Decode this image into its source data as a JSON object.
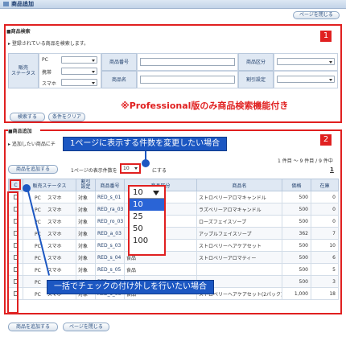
{
  "window": {
    "title": "商品追加",
    "close_label": "ページを閉じる"
  },
  "search": {
    "header": "■商品検索",
    "subtitle": "▸ 登録されている商品を検索します。",
    "status_label": "販売\nステータス",
    "status_rows": [
      {
        "label": "PC",
        "value": ""
      },
      {
        "label": "携帯",
        "value": ""
      },
      {
        "label": "スマホ",
        "value": ""
      }
    ],
    "product_number_label": "商品番号",
    "product_name_label": "商品名",
    "category_label": "商品区分",
    "discount_label": "割引設定",
    "search_button": "検索する",
    "clear_button": "条件をクリア",
    "note": "※Professional版のみ商品検索機能付き",
    "badge": "1"
  },
  "add": {
    "header": "■商品追加",
    "subtitle": "▸ 追加したい商品にチ",
    "badge": "2",
    "add_button": "商品を追加する",
    "per_page_prefix": "1ページの表示件数を",
    "per_page_value": "10",
    "per_page_suffix": "にする",
    "count_text": "1 件目 ～ 9 件目 / 9 件中",
    "page_number": "1",
    "columns": [
      "C",
      "販売ステータス",
      "割引\n設定",
      "商品番号",
      "商品区分",
      "商品名",
      "価格",
      "在庫"
    ],
    "rows": [
      {
        "status1": "PC",
        "status2": "スマホ",
        "discount": "対象",
        "number": "RED_s_01",
        "category": "",
        "name": "ストロベリーアロマキャンドル",
        "price": "500",
        "stock": "0"
      },
      {
        "status1": "PC",
        "status2": "スマホ",
        "discount": "対象",
        "number": "RED_ra_03",
        "category": "",
        "name": "ラズベリーアロマキャンドル",
        "price": "500",
        "stock": "0"
      },
      {
        "status1": "PC",
        "status2": "スマホ",
        "discount": "対象",
        "number": "RED_ro_03",
        "category": "",
        "name": "ローズフェイスソープ",
        "price": "500",
        "stock": "0"
      },
      {
        "status1": "PC",
        "status2": "スマホ",
        "discount": "対象",
        "number": "RED_a_03",
        "category": "",
        "name": "アップルフェイスソープ",
        "price": "362",
        "stock": "7"
      },
      {
        "status1": "PC",
        "status2": "スマホ",
        "discount": "対象",
        "number": "RED_s_03",
        "category": "",
        "name": "ストロベリーヘアケアセット",
        "price": "500",
        "stock": "10"
      },
      {
        "status1": "PC",
        "status2": "スマホ",
        "discount": "対象",
        "number": "RED_s_04",
        "category": "食品",
        "name": "ストロベリーアロマティー",
        "price": "500",
        "stock": "6"
      },
      {
        "status1": "PC",
        "status2": "スマホ",
        "discount": "対象",
        "number": "RED_s_05",
        "category": "食品",
        "name": "",
        "price": "500",
        "stock": "5"
      },
      {
        "status1": "PC",
        "status2": "スマホ",
        "discount": "対象",
        "number": "RED_c_05",
        "category": "",
        "name": "",
        "price": "500",
        "stock": "3"
      },
      {
        "status1": "PC",
        "status2": "スマホ",
        "discount": "対象",
        "number": "RED_s_06",
        "category": "食品",
        "name": "ストロベリーヘアケアセット(2パック)",
        "price": "1,000",
        "stock": "18"
      }
    ],
    "close_button": "ページを閉じる"
  },
  "per_page_dropdown": {
    "current": "10",
    "options": [
      "10",
      "25",
      "50",
      "100"
    ],
    "highlighted": "10"
  },
  "callouts": {
    "per_page": "1ページに表示する件数を変更したい場合",
    "bulk_check": "一括でチェックの付け外しを行いたい場合"
  }
}
